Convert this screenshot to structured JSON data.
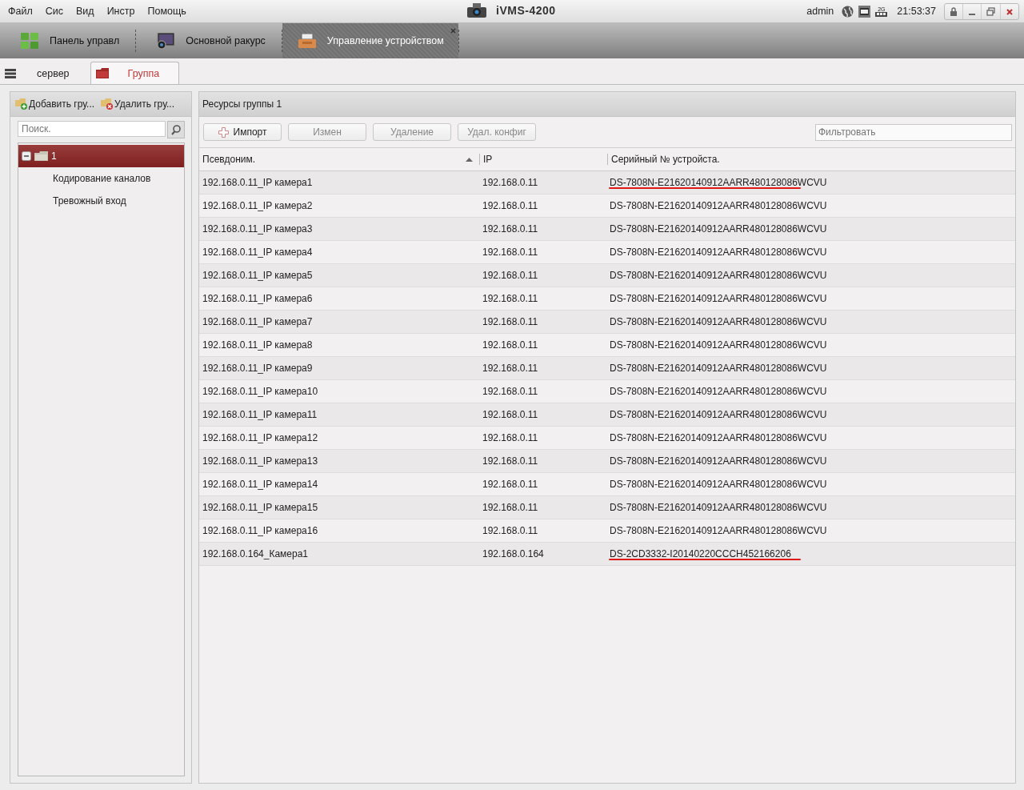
{
  "menu": [
    "Файл",
    "Сис",
    "Вид",
    "Инстр",
    "Помощь"
  ],
  "app_title": "iVMS-4200",
  "user": "admin",
  "clock": "21:53:37",
  "ram_label": "2G",
  "main_tabs": [
    {
      "label": "Панель управл",
      "selected": false,
      "closable": false
    },
    {
      "label": "Основной ракурс",
      "selected": false,
      "closable": false
    },
    {
      "label": "Управление устройством",
      "selected": true,
      "closable": true
    }
  ],
  "sub_tabs": [
    {
      "label": "сервер",
      "selected": false
    },
    {
      "label": "Группа",
      "selected": true
    }
  ],
  "left_panel": {
    "actions": [
      "Добавить гру...",
      "Удалить гру..."
    ],
    "search": {
      "placeholder": "Поиск."
    },
    "tree": [
      {
        "label": "1",
        "expanded": true,
        "selected": true,
        "children": [
          {
            "label": "Кодирование каналов",
            "selected": false
          },
          {
            "label": "Тревожный вход",
            "selected": false
          }
        ]
      }
    ]
  },
  "right_panel": {
    "title": "Ресурсы группы 1",
    "buttons": [
      {
        "label": "Импорт",
        "disabled": false
      },
      {
        "label": "Измен",
        "disabled": true
      },
      {
        "label": "Удаление",
        "disabled": true
      },
      {
        "label": "Удал. конфиг",
        "disabled": true
      }
    ],
    "filter": {
      "placeholder": "Фильтровать"
    },
    "table": {
      "columns": [
        {
          "label": "Псевдоним.",
          "sorted": true
        },
        {
          "label": "IP",
          "sorted": false
        },
        {
          "label": "Серийный № устройста.",
          "sorted": false
        }
      ],
      "rows": [
        {
          "alias": "192.168.0.11_IP камера1",
          "ip": "192.168.0.11",
          "serial": "DS-7808N-E21620140912AARR480128086WCVU",
          "underlined": true
        },
        {
          "alias": "192.168.0.11_IP камера2",
          "ip": "192.168.0.11",
          "serial": "DS-7808N-E21620140912AARR480128086WCVU",
          "underlined": false
        },
        {
          "alias": "192.168.0.11_IP камера3",
          "ip": "192.168.0.11",
          "serial": "DS-7808N-E21620140912AARR480128086WCVU",
          "underlined": false
        },
        {
          "alias": "192.168.0.11_IP камера4",
          "ip": "192.168.0.11",
          "serial": "DS-7808N-E21620140912AARR480128086WCVU",
          "underlined": false
        },
        {
          "alias": "192.168.0.11_IP камера5",
          "ip": "192.168.0.11",
          "serial": "DS-7808N-E21620140912AARR480128086WCVU",
          "underlined": false
        },
        {
          "alias": "192.168.0.11_IP камера6",
          "ip": "192.168.0.11",
          "serial": "DS-7808N-E21620140912AARR480128086WCVU",
          "underlined": false
        },
        {
          "alias": "192.168.0.11_IP камера7",
          "ip": "192.168.0.11",
          "serial": "DS-7808N-E21620140912AARR480128086WCVU",
          "underlined": false
        },
        {
          "alias": "192.168.0.11_IP камера8",
          "ip": "192.168.0.11",
          "serial": "DS-7808N-E21620140912AARR480128086WCVU",
          "underlined": false
        },
        {
          "alias": "192.168.0.11_IP камера9",
          "ip": "192.168.0.11",
          "serial": "DS-7808N-E21620140912AARR480128086WCVU",
          "underlined": false
        },
        {
          "alias": "192.168.0.11_IP камера10",
          "ip": "192.168.0.11",
          "serial": "DS-7808N-E21620140912AARR480128086WCVU",
          "underlined": false
        },
        {
          "alias": "192.168.0.11_IP камера11",
          "ip": "192.168.0.11",
          "serial": "DS-7808N-E21620140912AARR480128086WCVU",
          "underlined": false
        },
        {
          "alias": "192.168.0.11_IP камера12",
          "ip": "192.168.0.11",
          "serial": "DS-7808N-E21620140912AARR480128086WCVU",
          "underlined": false
        },
        {
          "alias": "192.168.0.11_IP камера13",
          "ip": "192.168.0.11",
          "serial": "DS-7808N-E21620140912AARR480128086WCVU",
          "underlined": false
        },
        {
          "alias": "192.168.0.11_IP камера14",
          "ip": "192.168.0.11",
          "serial": "DS-7808N-E21620140912AARR480128086WCVU",
          "underlined": false
        },
        {
          "alias": "192.168.0.11_IP камера15",
          "ip": "192.168.0.11",
          "serial": "DS-7808N-E21620140912AARR480128086WCVU",
          "underlined": false
        },
        {
          "alias": "192.168.0.11_IP камера16",
          "ip": "192.168.0.11",
          "serial": "DS-7808N-E21620140912AARR480128086WCVU",
          "underlined": false
        },
        {
          "alias": "192.168.0.164_Камера1",
          "ip": "192.168.0.164",
          "serial": "DS-2CD3332-I20140220CCCH452166206",
          "underlined": true
        }
      ]
    }
  }
}
